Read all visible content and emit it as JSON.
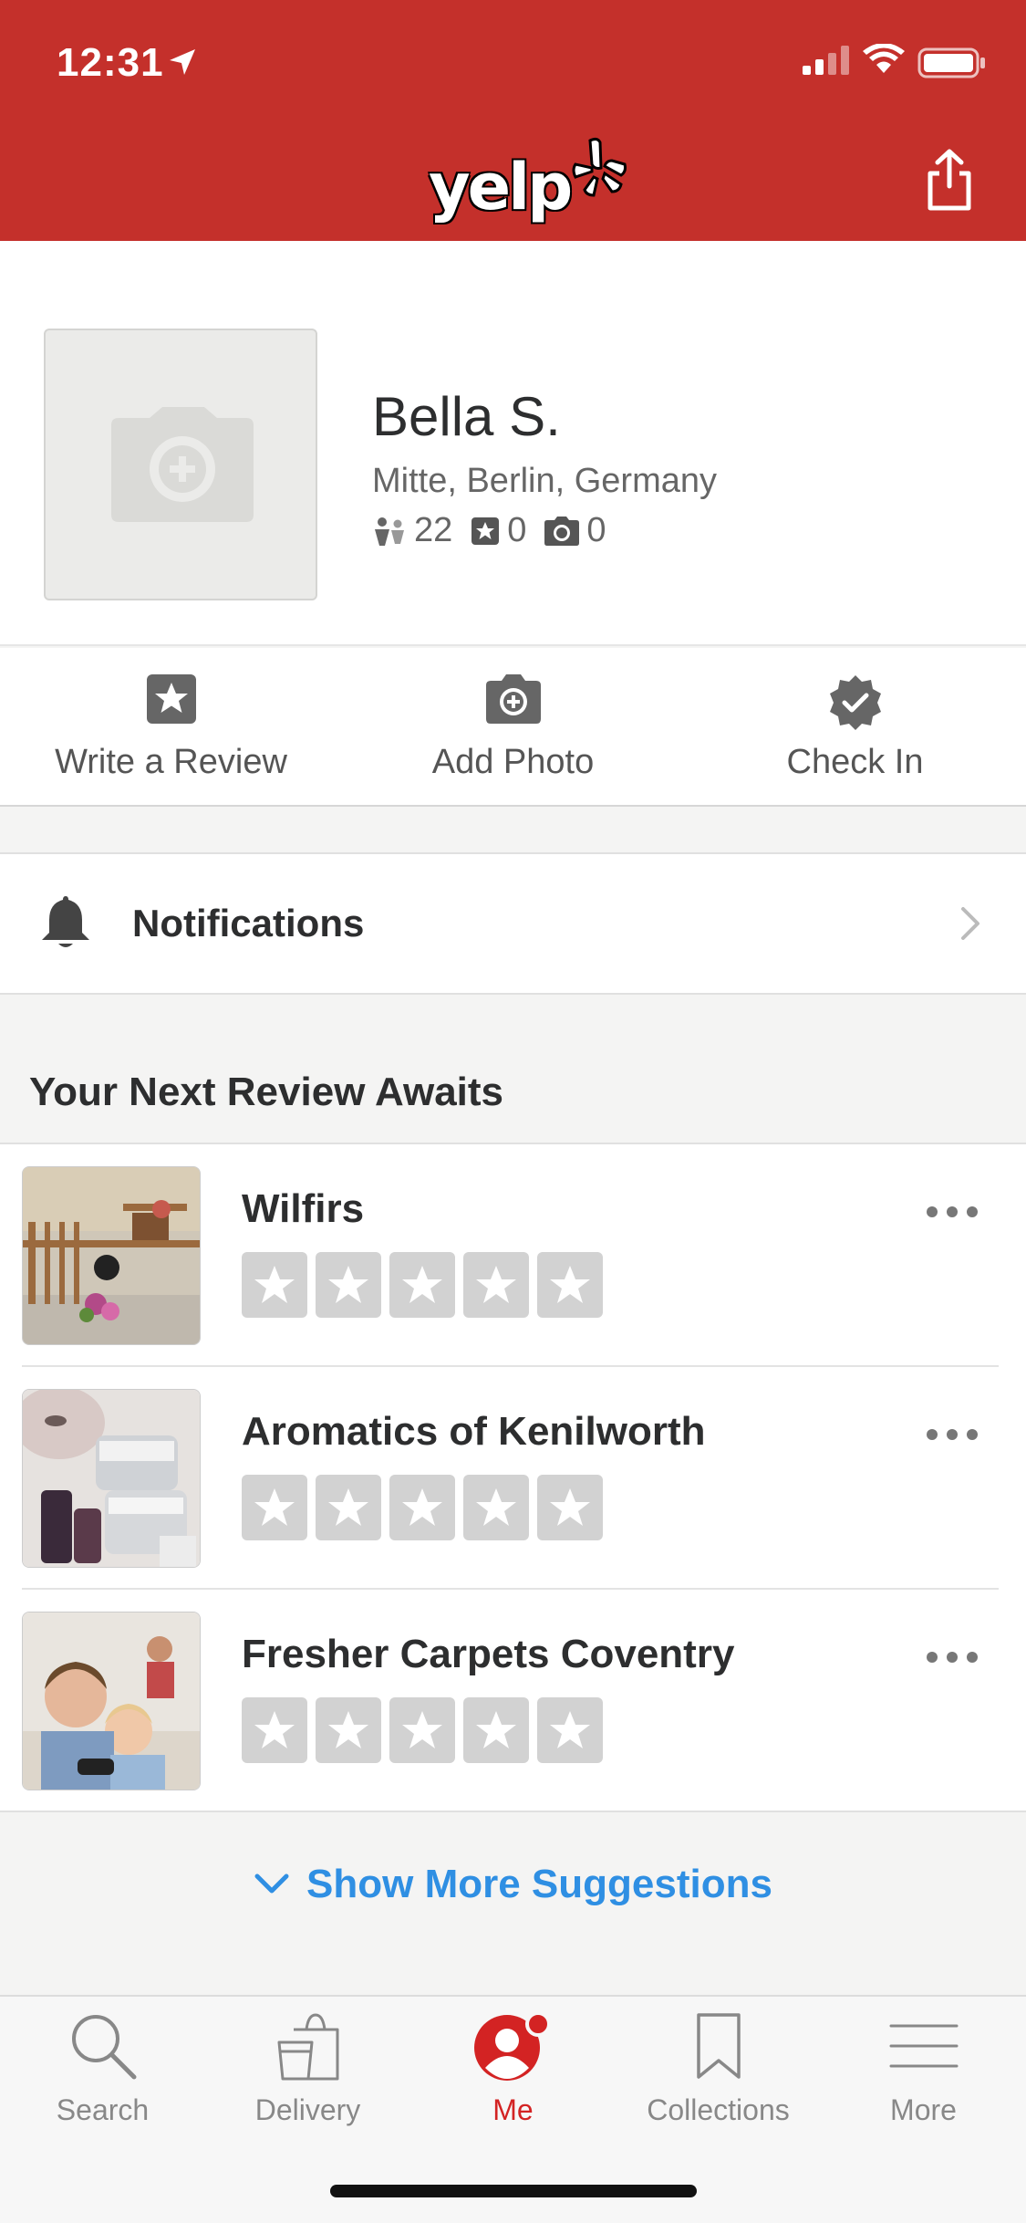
{
  "status_bar": {
    "time": "12:31"
  },
  "header": {
    "logo_text": "yelp"
  },
  "profile": {
    "name": "Bella S.",
    "location": "Mitte, Berlin, Germany",
    "friends_count": "22",
    "reviews_count": "0",
    "photos_count": "0"
  },
  "actions": [
    {
      "label": "Write a Review",
      "icon": "star-square-icon"
    },
    {
      "label": "Add Photo",
      "icon": "camera-icon"
    },
    {
      "label": "Check In",
      "icon": "check-badge-icon"
    }
  ],
  "notifications": {
    "label": "Notifications"
  },
  "suggestions": {
    "title": "Your Next Review Awaits",
    "items": [
      {
        "name": "Wilfirs",
        "rating": 0
      },
      {
        "name": "Aromatics of Kenilworth",
        "rating": 0
      },
      {
        "name": "Fresher Carpets Coventry",
        "rating": 0
      }
    ],
    "show_more": "Show More Suggestions"
  },
  "tabs": [
    {
      "label": "Search",
      "icon": "search-icon"
    },
    {
      "label": "Delivery",
      "icon": "delivery-bag-icon"
    },
    {
      "label": "Me",
      "icon": "me-avatar-icon",
      "active": true
    },
    {
      "label": "Collections",
      "icon": "bookmark-icon"
    },
    {
      "label": "More",
      "icon": "menu-icon"
    }
  ],
  "colors": {
    "brand_red": "#c4302b",
    "link_blue": "#2f8fe3",
    "active_tab": "#d32323"
  }
}
